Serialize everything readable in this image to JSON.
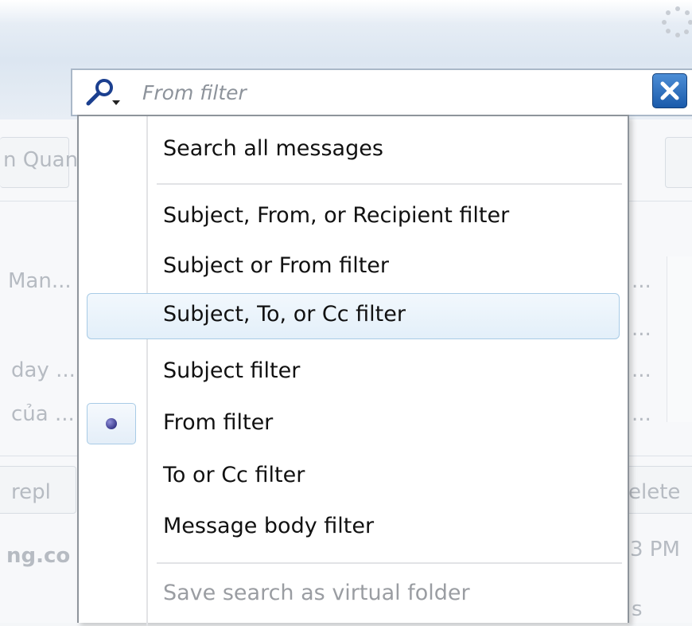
{
  "search": {
    "placeholder": "From filter",
    "icon": "magnifier-dropdown-icon",
    "clear_icon": "close-icon"
  },
  "background": {
    "toolbar_fragment": "n Quan",
    "list_rows": [
      "Man...",
      "day ...",
      "của ..."
    ],
    "list_right_cells": [
      "...",
      "...",
      "...",
      "..."
    ],
    "reply_fragment": "repl",
    "delete_fragment": "elete",
    "sender_fragment": "ng.co",
    "time_fragment": "3 PM",
    "bottom_fragment": "s"
  },
  "menu": {
    "items": [
      {
        "label": "Search all messages",
        "checked": false,
        "highlighted": false,
        "disabled": false
      },
      {
        "label": "Subject, From, or Recipient filter",
        "checked": false,
        "highlighted": false,
        "disabled": false
      },
      {
        "label": "Subject or From filter",
        "checked": false,
        "highlighted": false,
        "disabled": false
      },
      {
        "label": "Subject, To, or Cc filter",
        "checked": false,
        "highlighted": true,
        "disabled": false
      },
      {
        "label": "Subject filter",
        "checked": false,
        "highlighted": false,
        "disabled": false
      },
      {
        "label": "From filter",
        "checked": true,
        "highlighted": false,
        "disabled": false
      },
      {
        "label": "To or Cc filter",
        "checked": false,
        "highlighted": false,
        "disabled": false
      },
      {
        "label": "Message body filter",
        "checked": false,
        "highlighted": false,
        "disabled": false
      },
      {
        "label": "Save search as virtual folder",
        "checked": false,
        "highlighted": false,
        "disabled": true
      }
    ]
  },
  "colors": {
    "highlight_border": "#a8cbe6",
    "clear_button": "#1a5aaa",
    "radio_dot": "#3a3a8c"
  }
}
